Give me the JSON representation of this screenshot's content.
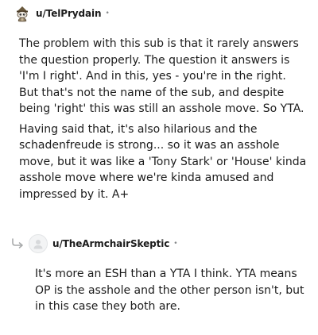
{
  "comments": [
    {
      "username": "u/TelPrydain",
      "separator": "•",
      "avatar_icon": "snoo-avatar-icon",
      "paragraphs": [
        "The problem with this sub is that it rarely answers the question properly. The question it answers is 'I'm I right'. And in this, yes - you're in the right. But that's not the name of the sub, and despite being 'right' this was still an asshole move. So YTA.",
        "Having said that, it's also hilarious and the schadenfreude is strong... so it was an asshole move, but it was like a 'Tony Stark' or 'House' kinda asshole move where we're kinda amused and impressed by it. A+"
      ]
    },
    {
      "username": "u/TheArmchairSkeptic",
      "separator": "•",
      "avatar_icon": "default-avatar-icon",
      "reply_icon": "reply-arrow-icon",
      "paragraphs": [
        "It's more an ESH than a YTA I think. YTA means OP is the asshole and the other person isn't, but in this case they both are."
      ]
    }
  ],
  "colors": {
    "text": "#1c1c1c",
    "meta": "#878a8c",
    "reply_arrow": "#a8aaab",
    "avatar_bg": "#f3f4f5"
  }
}
